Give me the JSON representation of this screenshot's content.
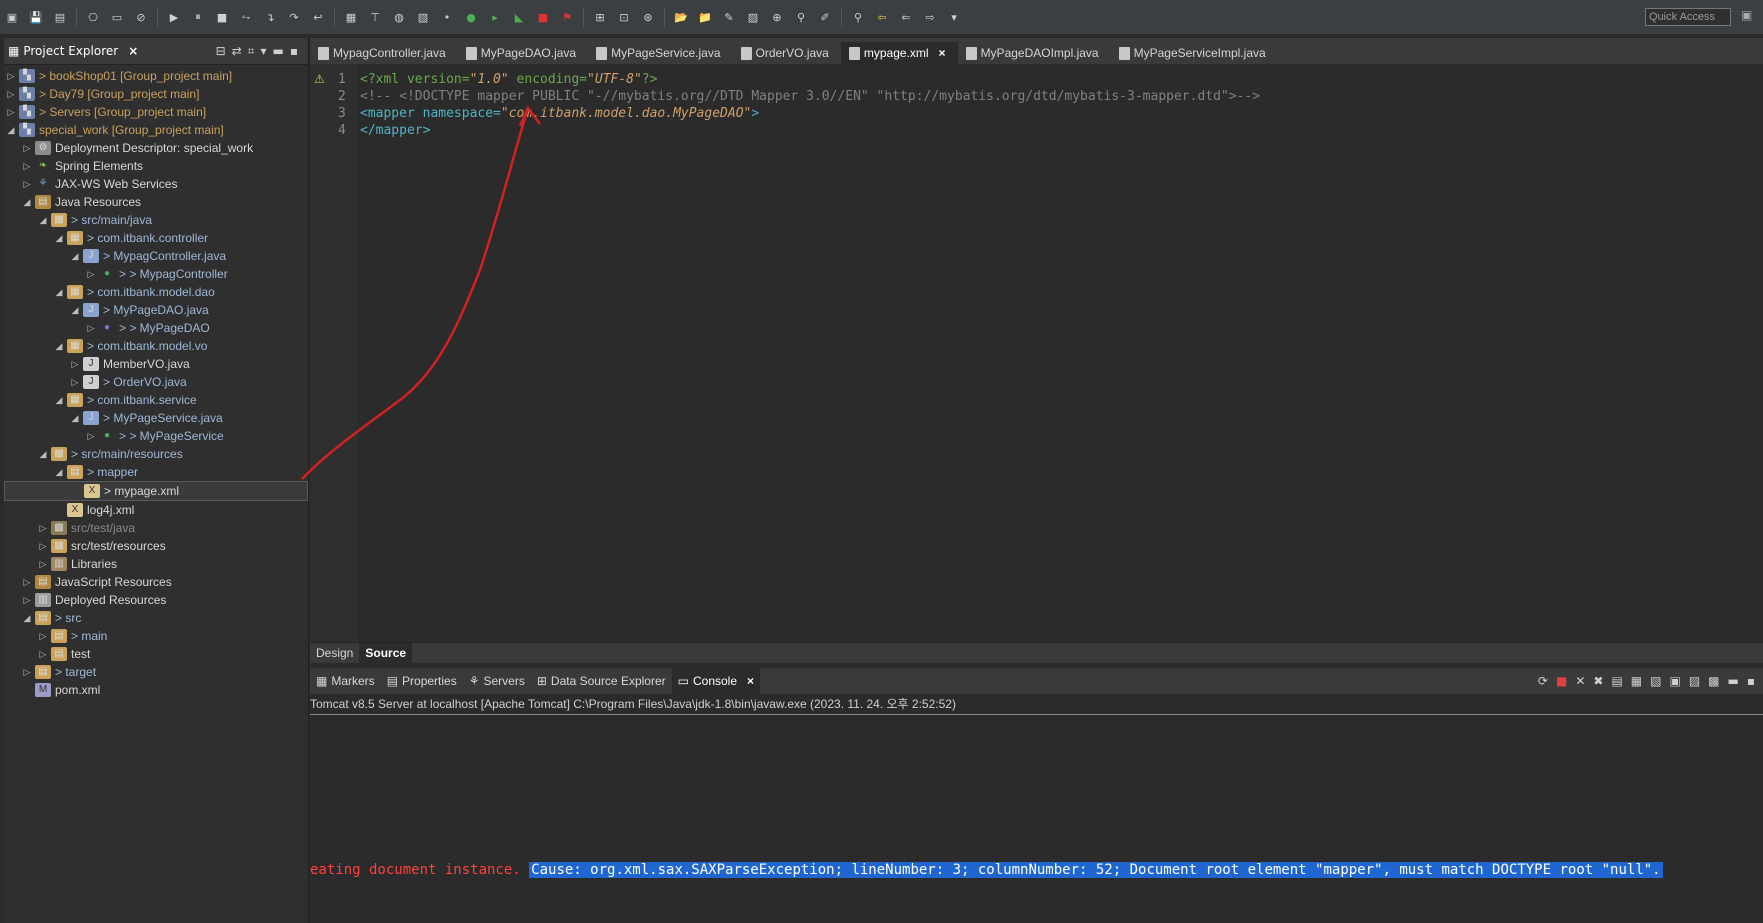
{
  "toolbar": {
    "quick_access_placeholder": "Quick Access"
  },
  "explorer": {
    "title": "Project Explorer",
    "items": [
      {
        "label": "> bookShop01 [Group_project main]"
      },
      {
        "label": "> Day79 [Group_project main]"
      },
      {
        "label": "> Servers [Group_project main]"
      },
      {
        "label": "special_work [Group_project main]"
      },
      {
        "label": "Deployment Descriptor: special_work"
      },
      {
        "label": "Spring Elements"
      },
      {
        "label": "JAX-WS Web Services"
      },
      {
        "label": "Java Resources"
      },
      {
        "label": "> src/main/java"
      },
      {
        "label": "> com.itbank.controller"
      },
      {
        "label": "> MypagController.java"
      },
      {
        "label": "> > MypagController"
      },
      {
        "label": "> com.itbank.model.dao"
      },
      {
        "label": "> MyPageDAO.java"
      },
      {
        "label": "> > MyPageDAO"
      },
      {
        "label": "> com.itbank.model.vo"
      },
      {
        "label": "MemberVO.java"
      },
      {
        "label": "> OrderVO.java"
      },
      {
        "label": "> com.itbank.service"
      },
      {
        "label": "> MyPageService.java"
      },
      {
        "label": "> > MyPageService"
      },
      {
        "label": "> src/main/resources"
      },
      {
        "label": "> mapper"
      },
      {
        "label": "> mypage.xml"
      },
      {
        "label": "log4j.xml"
      },
      {
        "label": "src/test/java"
      },
      {
        "label": "src/test/resources"
      },
      {
        "label": "Libraries"
      },
      {
        "label": "JavaScript Resources"
      },
      {
        "label": "Deployed Resources"
      },
      {
        "label": "> src"
      },
      {
        "label": "> main"
      },
      {
        "label": "test"
      },
      {
        "label": "> target"
      },
      {
        "label": "pom.xml"
      }
    ]
  },
  "editor": {
    "tabs": [
      {
        "label": "MypagController.java"
      },
      {
        "label": "MyPageDAO.java"
      },
      {
        "label": "MyPageService.java"
      },
      {
        "label": "OrderVO.java"
      },
      {
        "label": "mypage.xml",
        "active": true
      },
      {
        "label": "MyPageDAOImpl.java"
      },
      {
        "label": "MyPageServiceImpl.java"
      }
    ],
    "lines": [
      {
        "n": "1",
        "p1": "<?xml version=",
        "p2": "\"1.0\"",
        "p3": " encoding=",
        "p4": "\"UTF-8\"",
        "p5": "?>"
      },
      {
        "n": "2",
        "text": "<!-- <!DOCTYPE mapper PUBLIC \"-//mybatis.org//DTD Mapper 3.0//EN\" \"http://mybatis.org/dtd/mybatis-3-mapper.dtd\">-->"
      },
      {
        "n": "3",
        "p1": "<mapper namespace=",
        "p2": "\"com.itbank.model.dao.MyPageDAO\"",
        "p3": ">"
      },
      {
        "n": "4",
        "text": "</mapper>"
      }
    ],
    "design_tab": "Design",
    "source_tab": "Source"
  },
  "bottom": {
    "tabs": [
      {
        "label": "Markers"
      },
      {
        "label": "Properties"
      },
      {
        "label": "Servers"
      },
      {
        "label": "Data Source Explorer"
      },
      {
        "label": "Console",
        "active": true
      }
    ],
    "status": "Tomcat v8.5 Server at localhost [Apache Tomcat] C:\\Program Files\\Java\\jdk-1.8\\bin\\javaw.exe (2023. 11. 24. 오후 2:52:52)",
    "error_prefix": "eating document instance.  ",
    "error_selected": "Cause: org.xml.sax.SAXParseException; lineNumber: 3; columnNumber: 52; Document root element \"mapper\", must match DOCTYPE root \"null\"."
  }
}
